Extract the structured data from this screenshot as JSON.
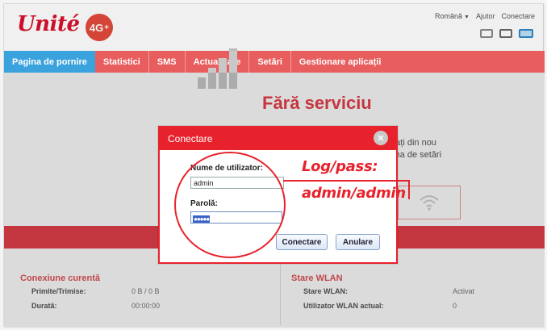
{
  "header": {
    "brand": "Unité",
    "badge_main": "4G",
    "badge_plus": "+",
    "language": "Română",
    "help": "Ajutor",
    "login": "Conectare"
  },
  "nav": {
    "tabs": [
      {
        "label": "Pagina de pornire"
      },
      {
        "label": "Statistici"
      },
      {
        "label": "SMS"
      },
      {
        "label": "Actualizare"
      },
      {
        "label": "Setări"
      },
      {
        "label": "Gestionare aplicații"
      }
    ]
  },
  "home": {
    "status_title": "Fără serviciu",
    "message_line1": "rcați din nou",
    "message_line2": "gina de setări"
  },
  "connection": {
    "title": "Conexiune curentă",
    "received_sent_label": "Primite/Trimise:",
    "received_sent_value": "0 B / 0 B",
    "duration_label": "Durată:",
    "duration_value": "00:00:00"
  },
  "wlan": {
    "title": "Stare WLAN",
    "status_label": "Stare WLAN:",
    "status_value": "Activat",
    "users_label": "Utilizator WLAN actual:",
    "users_value": "0"
  },
  "dialog": {
    "title": "Conectare",
    "username_label": "Nume de utilizator:",
    "username_value": "admin",
    "password_label": "Parolă:",
    "password_mask": "●●●●●",
    "login_button": "Conectare",
    "cancel_button": "Anulare"
  },
  "annotation": {
    "line1": "Log/pass:",
    "line2": "admin/admin"
  },
  "colors": {
    "brand_red": "#e8222c",
    "nav_red": "#e85d5d",
    "nav_active_blue": "#3aa3de"
  }
}
